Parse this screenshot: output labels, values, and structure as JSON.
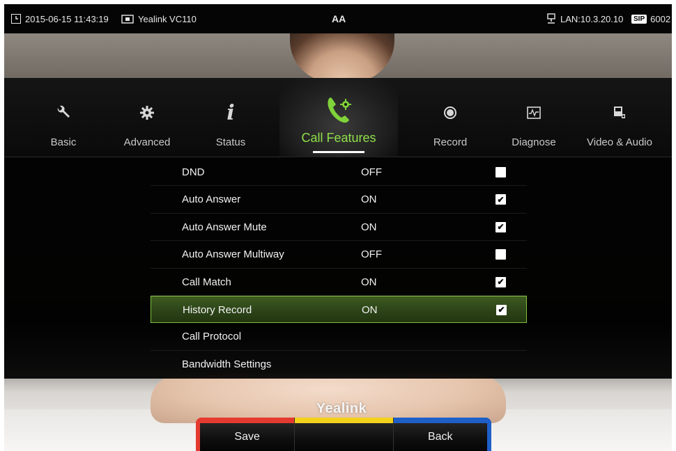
{
  "statusbar": {
    "datetime": "2015-06-15 11:43:19",
    "device": "Yealink VC110",
    "font_indicator": "AA",
    "lan": "LAN:10.3.20.10",
    "sip_badge": "SIP",
    "sip_account": "6002"
  },
  "tabs": [
    {
      "label": "Basic",
      "icon": "wrench-icon"
    },
    {
      "label": "Advanced",
      "icon": "gear-icon"
    },
    {
      "label": "Status",
      "icon": "info-icon"
    },
    {
      "label": "Call Features",
      "icon": "phone-gear-icon",
      "active": true
    },
    {
      "label": "Record",
      "icon": "record-icon"
    },
    {
      "label": "Diagnose",
      "icon": "waveform-icon"
    },
    {
      "label": "Video & Audio",
      "icon": "video-audio-icon"
    }
  ],
  "rows": [
    {
      "label": "DND",
      "value": "OFF",
      "checked": false
    },
    {
      "label": "Auto Answer",
      "value": "ON",
      "checked": true
    },
    {
      "label": "Auto Answer Mute",
      "value": "ON",
      "checked": true
    },
    {
      "label": "Auto Answer Multiway",
      "value": "OFF",
      "checked": false
    },
    {
      "label": "Call Match",
      "value": "ON",
      "checked": true
    },
    {
      "label": "History Record",
      "value": "ON",
      "checked": true,
      "selected": true
    },
    {
      "label": "Call Protocol"
    },
    {
      "label": "Bandwidth Settings"
    }
  ],
  "softkeys": {
    "save": "Save",
    "middle": "",
    "back": "Back"
  },
  "brand": "Yealink",
  "colors": {
    "accent_green": "#8fe04a",
    "selected_row": "#2c4418",
    "softkey_red": "#e53a2f",
    "softkey_yellow": "#f2d21b",
    "softkey_blue": "#1f5fc8"
  }
}
